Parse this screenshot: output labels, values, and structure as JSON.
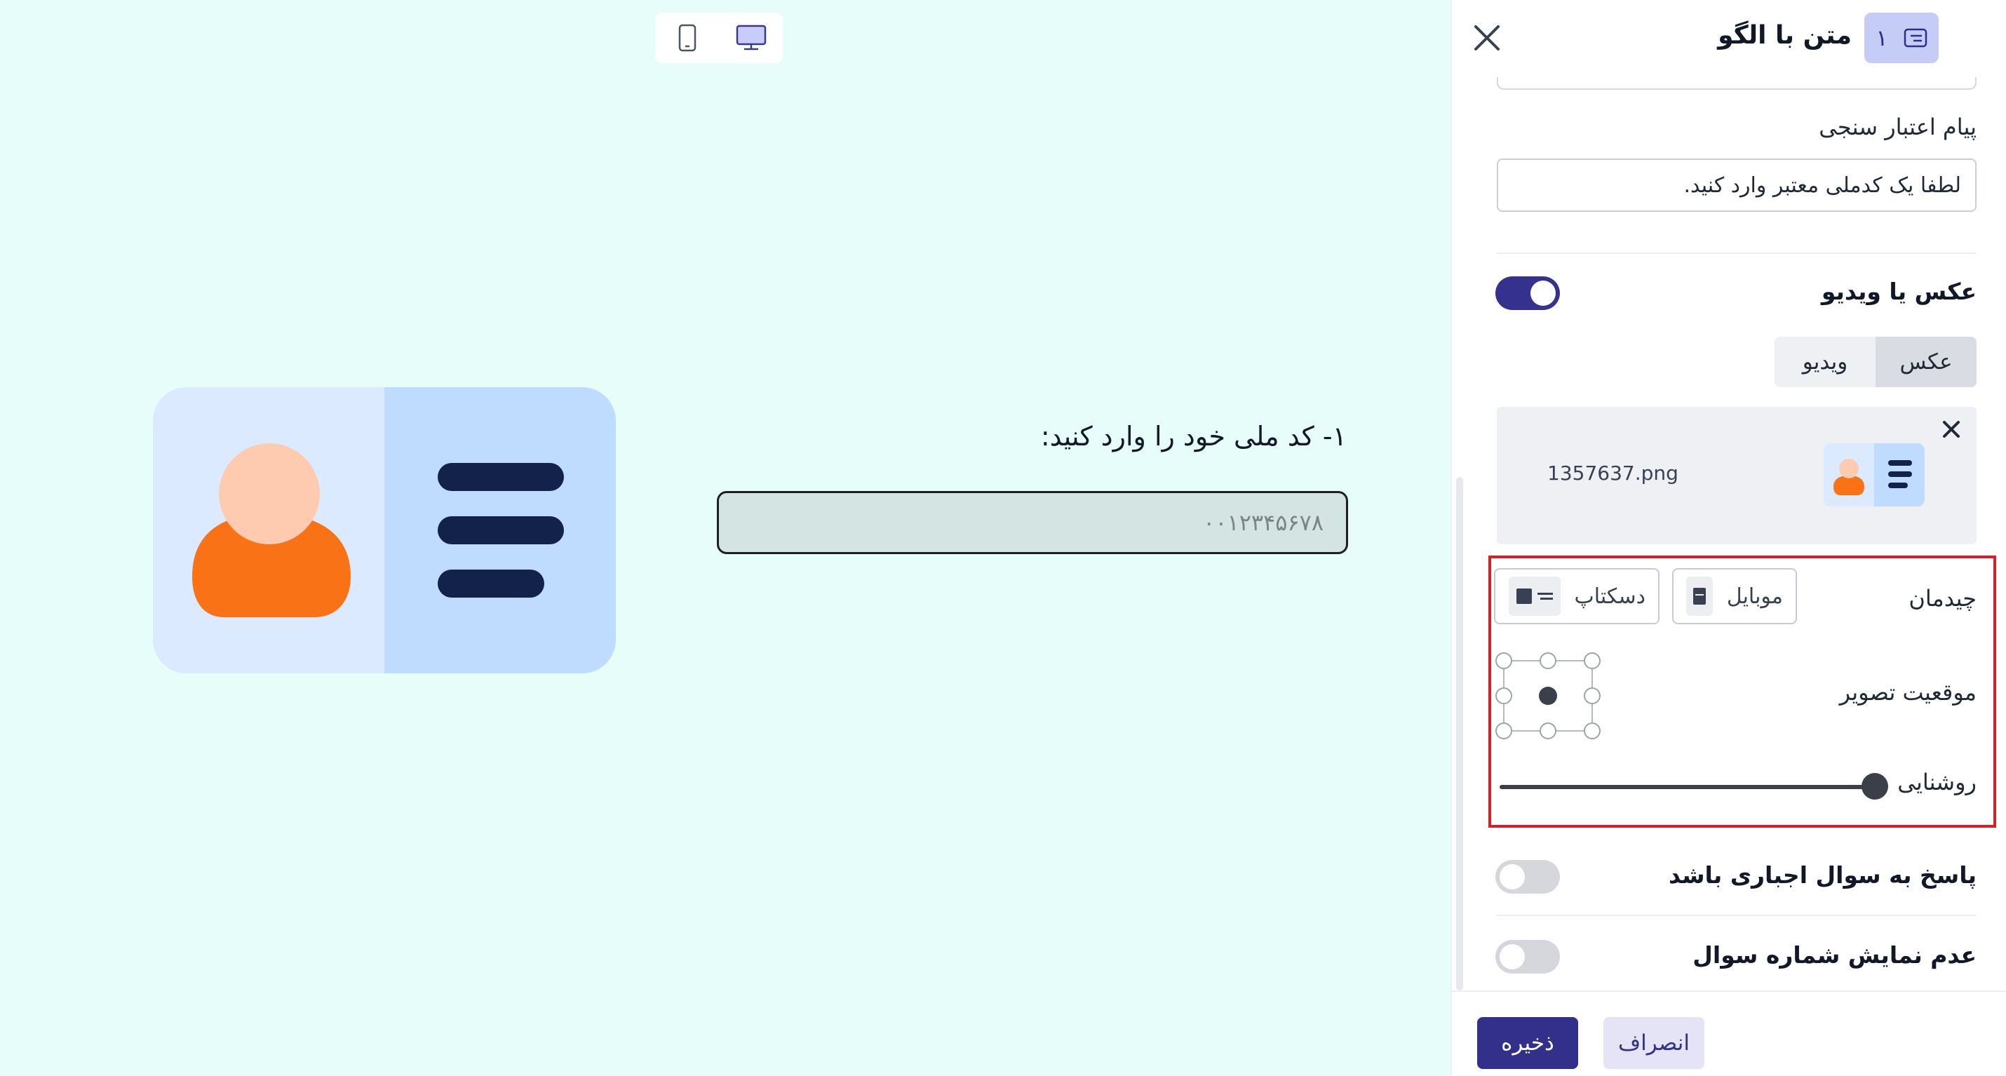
{
  "preview": {
    "question_title": "۱- کد ملی خود را وارد کنید:",
    "answer_placeholder": "۰۰۱۲۳۴۵۶۷۸"
  },
  "panel": {
    "header": {
      "title": "متن با الگو",
      "badge_number": "۱"
    },
    "validation": {
      "label": "پیام اعتبار سنجی",
      "value": "لطفا یک کدملی معتبر وارد کنید."
    },
    "media": {
      "label": "عکس یا ویدیو",
      "enabled": true,
      "tabs": [
        "عکس",
        "ویدیو"
      ],
      "active_tab": "عکس",
      "file_name": "1357637.png"
    },
    "layout": {
      "label": "چیدمان",
      "options": [
        "موبایل",
        "دسکتاپ"
      ]
    },
    "image_position": {
      "label": "موقعیت تصویر",
      "selected": "center"
    },
    "brightness": {
      "label": "روشنایی",
      "value": 1.0
    },
    "required": {
      "label": "پاسخ به سوال اجباری باشد",
      "enabled": false
    },
    "hide_number": {
      "label": "عدم نمایش شماره سوال",
      "enabled": false
    },
    "footer": {
      "save_label": "ذخیره",
      "cancel_label": "انصراف"
    }
  },
  "colors": {
    "preview_bg": "#e6fdfa",
    "accent": "#33308b",
    "highlight": "#d81f26",
    "card_left": "#dbeafe",
    "card_right": "#bfdbfe",
    "avatar_head": "#fecbb0",
    "avatar_body": "#f97316",
    "card_lines": "#13224a"
  },
  "icons": [
    "mobile-icon",
    "desktop-icon",
    "close-icon",
    "text-card-icon",
    "remove-file-icon"
  ]
}
